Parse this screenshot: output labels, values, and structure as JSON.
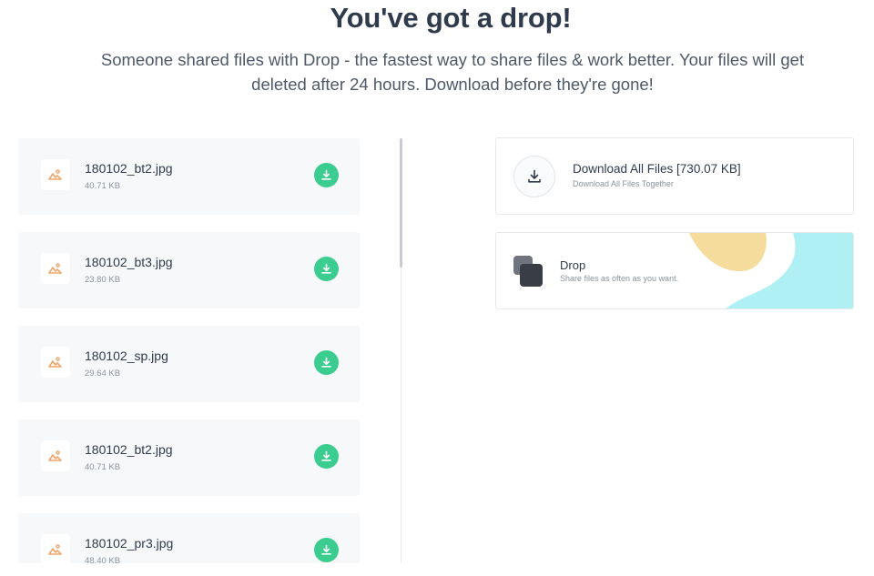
{
  "header": {
    "title": "You've got a drop!",
    "subtitle": "Someone shared files with Drop - the fastest way to share files & work better. Your files will get deleted after 24 hours. Download before they're gone!"
  },
  "files": [
    {
      "name": "180102_bt2.jpg",
      "size": "40.71 KB"
    },
    {
      "name": "180102_bt3.jpg",
      "size": "23.80 KB"
    },
    {
      "name": "180102_sp.jpg",
      "size": "29.64 KB"
    },
    {
      "name": "180102_bt2.jpg",
      "size": "40.71 KB"
    },
    {
      "name": "180102_pr3.jpg",
      "size": "48.40 KB"
    }
  ],
  "download_all": {
    "title": "Download All Files [730.07 KB]",
    "subtitle": "Download All Files Together"
  },
  "promo": {
    "title": "Drop",
    "subtitle": "Share files as often as you want."
  },
  "icons": {
    "file_thumb": "image-file-icon",
    "download": "download-icon",
    "logo": "drop-logo-icon"
  },
  "colors": {
    "accent_green": "#3bcd8f",
    "thumb_orange": "#f0a56a",
    "promo_yellow": "#f6dc9c",
    "promo_cyan": "#aef0f4",
    "text_dark": "#2f3b4c"
  }
}
